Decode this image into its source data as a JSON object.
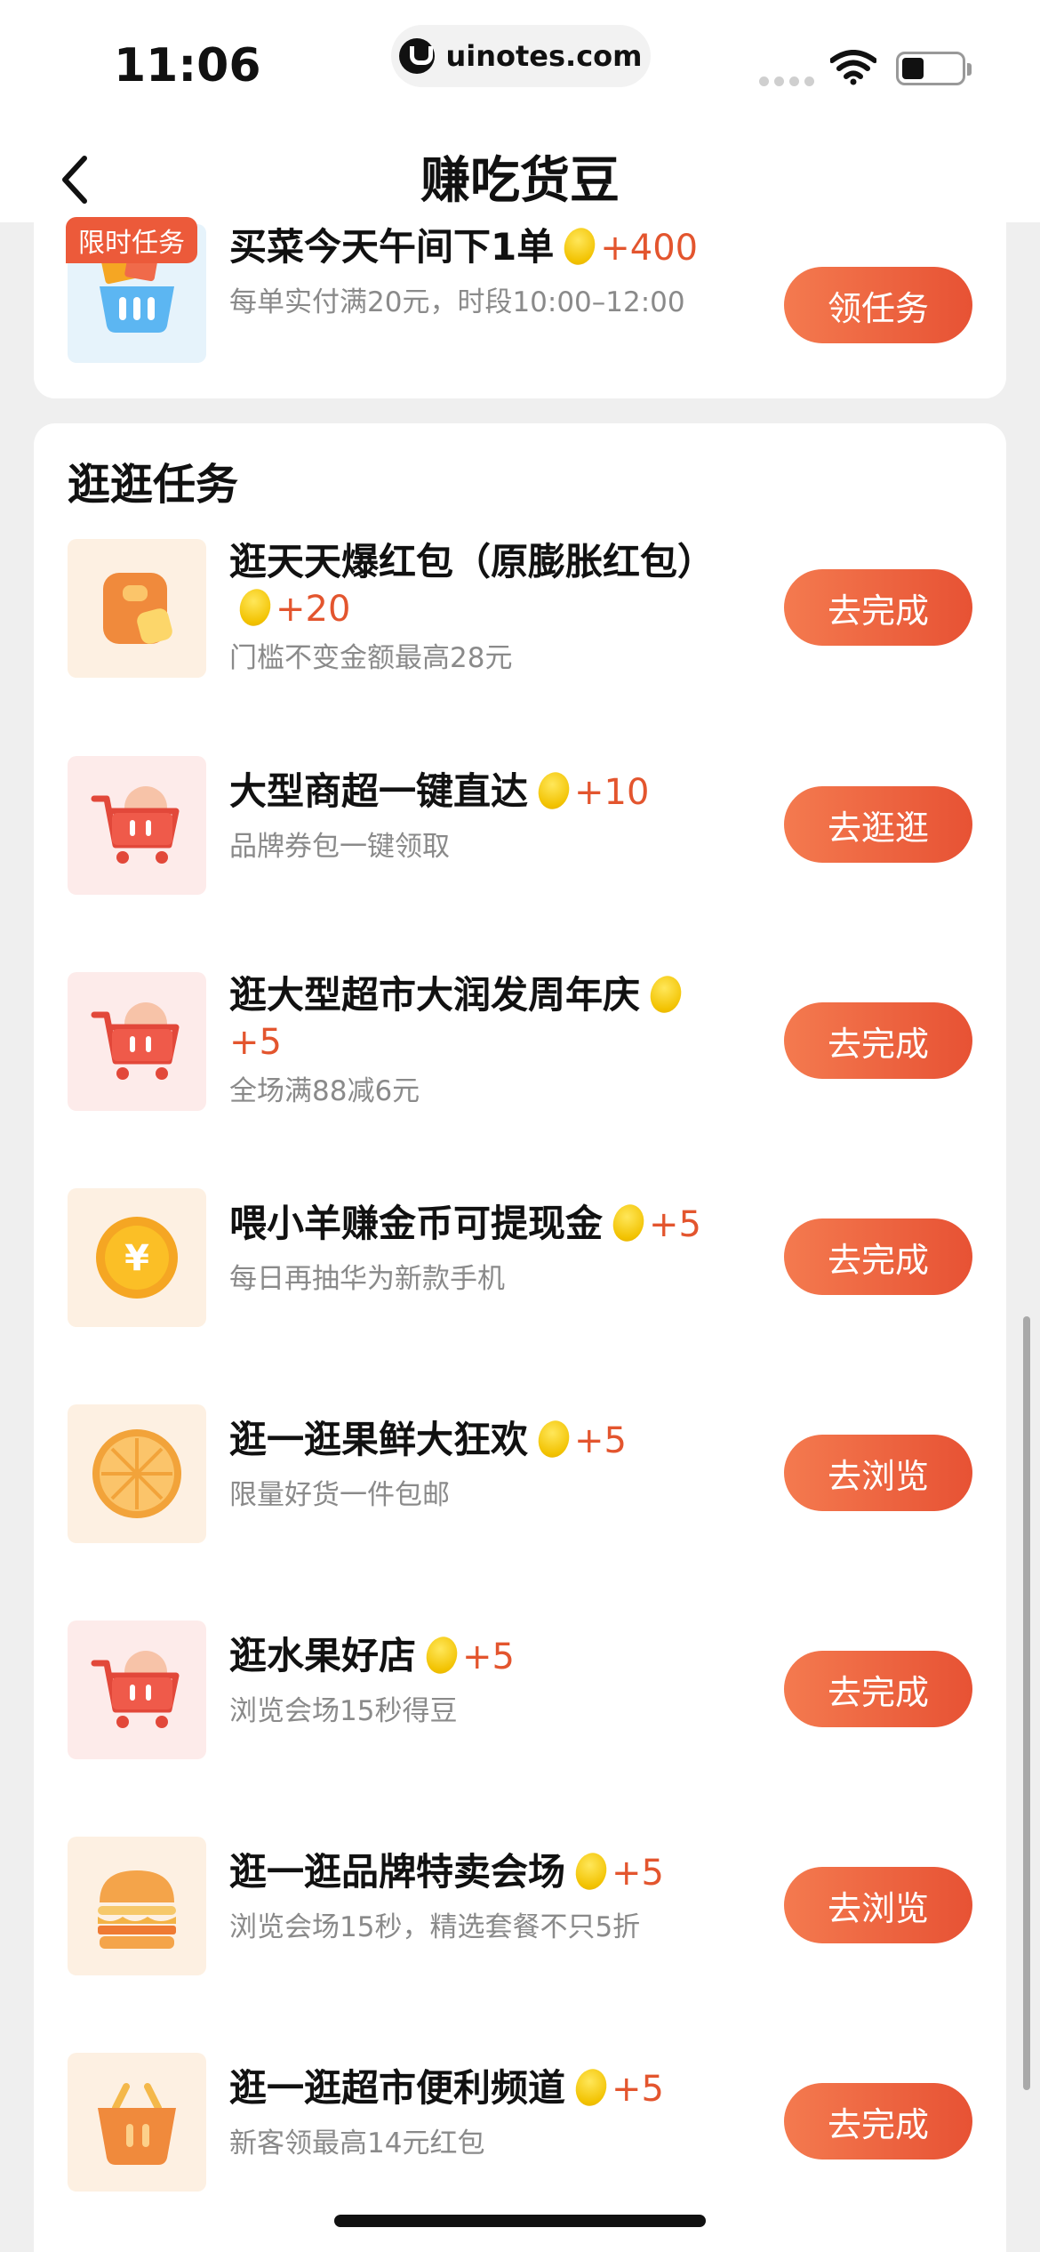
{
  "status_bar": {
    "time": "11:06",
    "url": "uinotes.com"
  },
  "nav": {
    "title": "赚吃货豆"
  },
  "limited_task": {
    "badge": "限时任务",
    "title": "买菜今天午间下1单",
    "reward": "+400",
    "subtitle": "每单实付满20元，时段10:00–12:00",
    "button": "领任务"
  },
  "section": {
    "title": "逛逛任务"
  },
  "tasks": [
    {
      "title": "逛天天爆红包（原膨胀红包）",
      "reward": "+20",
      "subtitle": "门槛不变金额最高28元",
      "button": "去完成",
      "icon": "red-envelope-icon"
    },
    {
      "title": "大型商超一键直达",
      "reward": "+10",
      "subtitle": "品牌券包一键领取",
      "button": "去逛逛",
      "icon": "shopping-cart-icon"
    },
    {
      "title": "逛大型超市大润发周年庆",
      "reward": "+5",
      "subtitle": "全场满88减6元",
      "button": "去完成",
      "icon": "shopping-cart-icon"
    },
    {
      "title": "喂小羊赚金币可提现金",
      "reward": "+5",
      "subtitle": "每日再抽华为新款手机",
      "button": "去完成",
      "icon": "yuan-coin-icon"
    },
    {
      "title": "逛一逛果鲜大狂欢",
      "reward": "+5",
      "subtitle": "限量好货一件包邮",
      "button": "去浏览",
      "icon": "orange-slice-icon"
    },
    {
      "title": "逛水果好店",
      "reward": "+5",
      "subtitle": "浏览会场15秒得豆",
      "button": "去完成",
      "icon": "shopping-cart-icon"
    },
    {
      "title": "逛一逛品牌特卖会场",
      "reward": "+5",
      "subtitle": "浏览会场15秒，精选套餐不只5折",
      "button": "去浏览",
      "icon": "burger-icon"
    },
    {
      "title": "逛一逛超市便利频道",
      "reward": "+5",
      "subtitle": "新客领最高14元红包",
      "button": "去完成",
      "icon": "basket-icon"
    }
  ],
  "colors": {
    "accent": "#e75234",
    "reward": "#e3552e",
    "page_bg": "#efefef"
  }
}
